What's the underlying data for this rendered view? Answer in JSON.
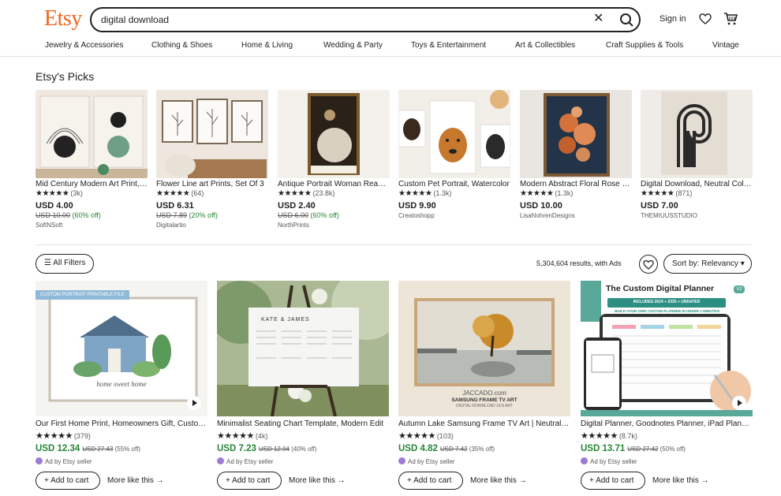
{
  "header": {
    "logo": "Etsy",
    "search_value": "digital download",
    "clear_glyph": "✕",
    "sign_in": "Sign in",
    "categories": [
      "Jewelry & Accessories",
      "Clothing & Shoes",
      "Home & Living",
      "Wedding & Party",
      "Toys & Entertainment",
      "Art & Collectibles",
      "Craft Supplies & Tools",
      "Vintage"
    ]
  },
  "picks": {
    "title": "Etsy's Picks",
    "items": [
      {
        "title": "Mid Century Modern Art Print, Abstract",
        "stars": "★★★★★",
        "count": "(3k)",
        "price": "USD 4.00",
        "old": "USD 10.00",
        "off": "(60% off)",
        "shop": "SoftNSoft"
      },
      {
        "title": "Flower Line art Prints, Set Of 3",
        "stars": "★★★★★",
        "count": "(64)",
        "price": "USD 6.31",
        "old": "USD 7.89",
        "off": "(20% off)",
        "shop": "Digitalartio"
      },
      {
        "title": "Antique Portrait Woman Reading",
        "stars": "★★★★★",
        "count": "(23.8k)",
        "price": "USD 2.40",
        "old": "USD 6.00",
        "off": "(60% off)",
        "shop": "NorthPrints"
      },
      {
        "title": "Custom Pet Portrait, Watercolor",
        "stars": "★★★★★",
        "count": "(1.3k)",
        "price": "USD 9.90",
        "old": "",
        "off": "",
        "shop": "Creatoshopp"
      },
      {
        "title": "Modern Abstract Floral Rose Print",
        "stars": "★★★★★",
        "count": "(1.3k)",
        "price": "USD 10.00",
        "old": "",
        "off": "",
        "shop": "LisaNohrenDesigns"
      },
      {
        "title": "Digital Download, Neutral Colors",
        "stars": "★★★★★",
        "count": "(871)",
        "price": "USD 7.00",
        "old": "",
        "off": "",
        "shop": "THEMIUUSSTUDIO"
      }
    ]
  },
  "toolbar": {
    "filters": "All Filters",
    "results": "5,304,604 results, with Ads",
    "sort": "Sort by: Relevancy ▾"
  },
  "listings": [
    {
      "title": "Our First Home Print, Homeowners Gift, Custom House Portrait",
      "stars": "★★★★★",
      "count": "(379)",
      "price": "USD 12.34",
      "old": "USD 27.43",
      "off": "(55% off)",
      "ad": "Ad by Etsy seller",
      "tag": "CUSTOM PORTRAIT PRINTABLE FILE"
    },
    {
      "title": "Minimalist Seating Chart Template, Modern Edit",
      "stars": "★★★★★",
      "count": "(4k)",
      "price": "USD 7.23",
      "old": "USD 12.04",
      "off": "(40% off)",
      "ad": "Ad by Etsy seller",
      "tag": ""
    },
    {
      "title": "Autumn Lake Samsung Frame TV Art | Neutral Painting",
      "stars": "★★★★★",
      "count": "(103)",
      "price": "USD 4.82",
      "old": "USD 7.42",
      "off": "(35% off)",
      "ad": "Ad by Etsy seller",
      "tag": ""
    },
    {
      "title": "Digital Planner, Goodnotes Planner, iPad Planner",
      "stars": "★★★★★",
      "count": "(8.7k)",
      "price": "USD 13.71",
      "old": "USD 27.42",
      "off": "(50% off)",
      "ad": "Ad by Etsy seller",
      "tag": ""
    }
  ],
  "card_labels": {
    "add_to_cart": "+ Add to cart",
    "more_like": "More like this →"
  },
  "image_text": {
    "home_script": "home sweet home",
    "seating_names": "KATE & JAMES",
    "tv_brand": "JACCADO.com",
    "tv_caption": "SAMSUNG FRAME TV ART",
    "tv_sub": "DIGITAL DOWNLOAD 16:9 ART",
    "planner_title": "The Custom Digital Planner",
    "planner_badge": "V2",
    "planner_strip": "INCLUDES 2024 + 2025 + UNDATED",
    "planner_sub": "BUILD YOUR OWN CUSTOM PLANNER IN UNDER 2 MINUTES!"
  },
  "colors": {
    "brand": "#f1641e",
    "sale": "#258635",
    "ad_dot": "#9b7bd4"
  }
}
